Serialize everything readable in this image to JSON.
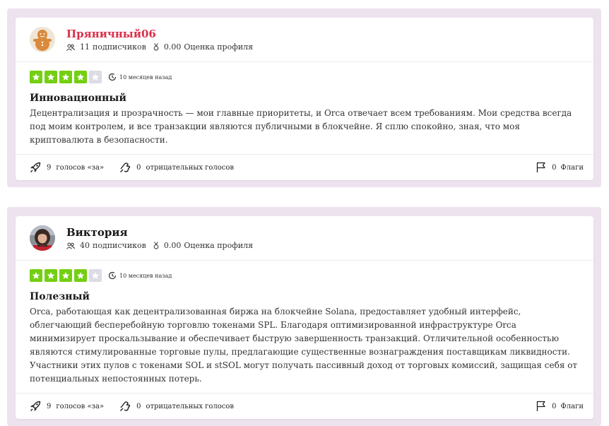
{
  "reviews": [
    {
      "author": "Пряничный06",
      "followers_count": "11",
      "followers_label": "подписчиков",
      "profile_score": "0.00",
      "profile_score_label": "Оценка профиля",
      "rating": 4,
      "time_ago": "10 месяцев назад",
      "title": "Инновационный",
      "text": "Децентрализация и прозрачность — мои главные приоритеты, и Orca отвечает всем требованиям. Мои средства всегда под моим контролем, и все транзакции являются публичными в блокчейне. Я сплю спокойно, зная, что моя криптовалюта в безопасности.",
      "upvotes": "9",
      "upvotes_label": "голосов «за»",
      "downvotes": "0",
      "downvotes_label": "отрицательных голосов",
      "flags": "0",
      "flags_label": "Флаги"
    },
    {
      "author": "Виктория",
      "followers_count": "40",
      "followers_label": "подписчиков",
      "profile_score": "0.00",
      "profile_score_label": "Оценка профиля",
      "rating": 4,
      "time_ago": "10 месяцев назад",
      "title": "Полезный",
      "text": "Orca, работающая как децентрализованная биржа на блокчейне Solana, предоставляет удобный интерфейс, облегчающий бесперебойную торговлю токенами SPL. Благодаря оптимизированной инфраструктуре Orca минимизирует проскальзывание и обеспечивает быструю завершенность транзакций. Отличительной особенностью являются стимулированные торговые пулы, предлагающие существенные вознаграждения поставщикам ликвидности. Участники этих пулов с токенами SOL и stSOL могут получать пассивный доход от торговых комиссий, защищая себя от потенциальных непостоянных потерь.",
      "upvotes": "9",
      "upvotes_label": "голосов «за»",
      "downvotes": "0",
      "downvotes_label": "отрицательных голосов",
      "flags": "0",
      "flags_label": "Флаги"
    }
  ],
  "colors": {
    "star_on": "#73cf11",
    "star_off": "#dcdce6",
    "author_highlight": "#d8314c",
    "outer_bg": "#ede3ee"
  },
  "icons": [
    "followers-icon",
    "badge-icon",
    "clock-icon",
    "rocket-icon",
    "thumbs-down-icon",
    "flag-icon",
    "star-icon"
  ]
}
